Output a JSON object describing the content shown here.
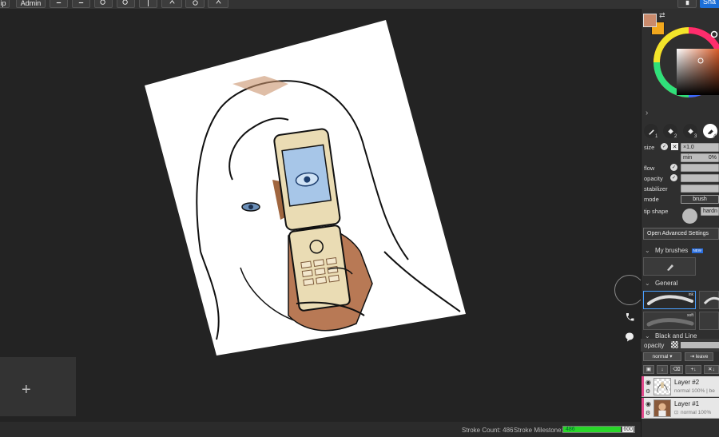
{
  "toolbar": {
    "left_label": "ip",
    "admin_label": "Admin",
    "share_label": "Sha"
  },
  "canvas": {
    "new_frame_symbol": "+"
  },
  "status": {
    "stroke_count": "Stroke Count: 486",
    "stroke_milestone_label": "Stroke Milestone:",
    "milestone_value": "486",
    "milestone_max": "600",
    "milestone_fraction": 0.81
  },
  "colors": {
    "foreground": "#c98a6c",
    "background": "#f2a81d",
    "accent": "#2a6ede",
    "milestone_fill": "#29d629",
    "layer_marker": "#e24a8c"
  },
  "brush_panel": {
    "tools": [
      "pen-icon",
      "fill-icon",
      "fill-alt-icon",
      "eraser-icon"
    ],
    "tool_numbers": [
      "1",
      "2",
      "3",
      "4"
    ],
    "size_label": "size",
    "size_value": "×1.0",
    "min_label": "min",
    "min_value": "0%",
    "flow_label": "flow",
    "opacity_label": "opacity",
    "stabilizer_label": "stabilizer",
    "mode_label": "mode",
    "mode_value": "brush",
    "tip_shape_label": "tip shape",
    "hardness_label": "hardn",
    "advanced_button": "Open Advanced Settings"
  },
  "brush_library": {
    "my_brushes_label": "My brushes",
    "new_badge": "NEW",
    "general_label": "General",
    "brushes": [
      "ink",
      "soft"
    ],
    "next_section_label": "Black and Line"
  },
  "layers_panel": {
    "opacity_label": "opacity",
    "blend_mode": "normal",
    "leave_label": "leave",
    "layers": [
      {
        "name": "Layer #2",
        "meta": "normal 100% | be"
      },
      {
        "name": "Layer #1",
        "meta": "normal 100%"
      }
    ]
  }
}
